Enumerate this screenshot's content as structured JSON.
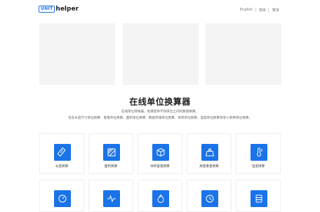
{
  "header": {
    "logo_box": "UNIT",
    "logo_text": "helper",
    "langs": [
      "English",
      "简体",
      "繁体"
    ]
  },
  "main": {
    "title": "在线单位换算器",
    "description": [
      "在线单位转换器，免费提供不同单位之间的数值换算。",
      "包含长度尺寸单位换算、重量单位换算、面积单位换算、数据存储单位换算、体积单位换算、温度单位换算等等十余种单位换算。"
    ]
  },
  "tools": [
    {
      "label": "长度换算",
      "icon": "ruler-icon"
    },
    {
      "label": "面积换算",
      "icon": "area-icon"
    },
    {
      "label": "体积容量换算",
      "icon": "cube-icon"
    },
    {
      "label": "质量重量换算",
      "icon": "weight-icon"
    },
    {
      "label": "温度换算",
      "icon": "thermometer-icon"
    },
    {
      "label": "",
      "icon": "pressure-icon"
    },
    {
      "label": "",
      "icon": "pulse-icon"
    },
    {
      "label": "",
      "icon": "flame-icon"
    },
    {
      "label": "",
      "icon": "clock-icon"
    },
    {
      "label": "",
      "icon": "storage-icon"
    }
  ],
  "colors": {
    "accent": "#1a73e8",
    "placeholder": "#f4f4f4"
  }
}
